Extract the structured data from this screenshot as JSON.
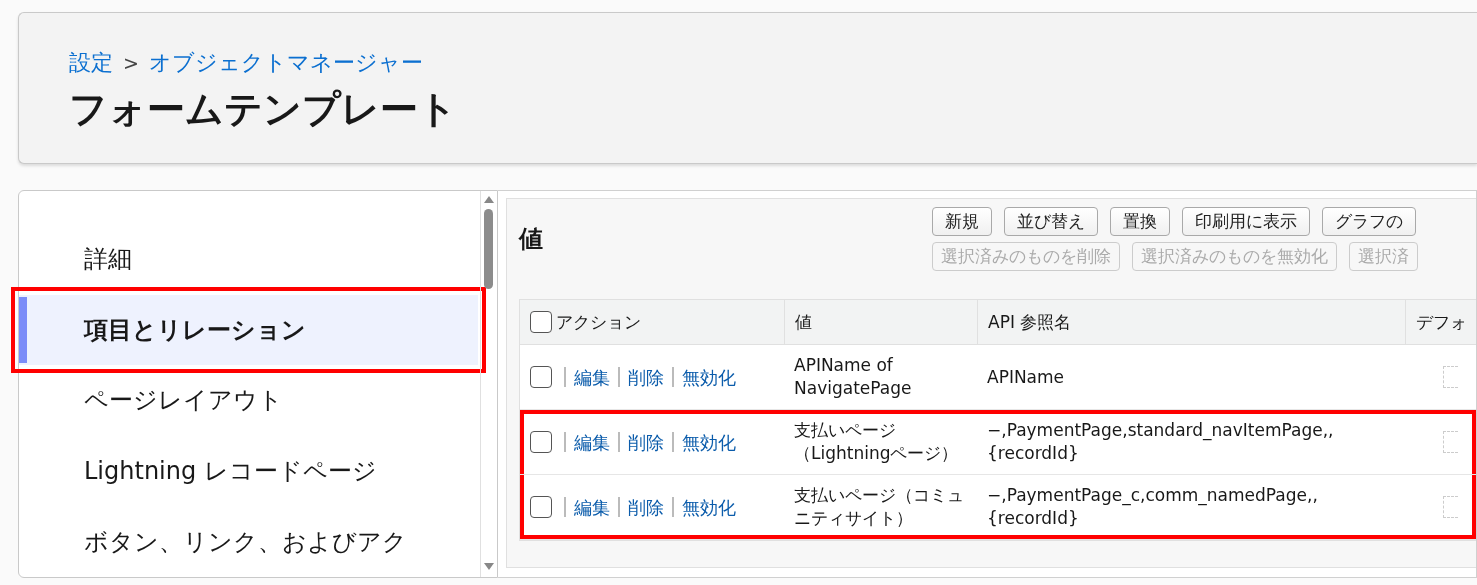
{
  "header": {
    "breadcrumb": [
      {
        "label": "設定"
      },
      {
        "label": "オブジェクトマネージャー"
      }
    ],
    "breadcrumb_separator": ">",
    "title": "フォームテンプレート"
  },
  "sidebar": {
    "items": [
      {
        "label": "詳細",
        "selected": false,
        "highlighted": false
      },
      {
        "label": "項目とリレーション",
        "selected": true,
        "highlighted": true
      },
      {
        "label": "ページレイアウト",
        "selected": false,
        "highlighted": false
      },
      {
        "label": "Lightning レコードページ",
        "selected": false,
        "highlighted": false
      },
      {
        "label": "ボタン、リンク、およびアク",
        "selected": false,
        "highlighted": false
      }
    ]
  },
  "panel": {
    "title": "値",
    "buttons": [
      {
        "label": "新規",
        "disabled": false
      },
      {
        "label": "並び替え",
        "disabled": false
      },
      {
        "label": "置換",
        "disabled": false
      },
      {
        "label": "印刷用に表示",
        "disabled": false
      },
      {
        "label": "グラフの",
        "disabled": false
      }
    ],
    "bulk_buttons": [
      {
        "label": "選択済みのものを削除",
        "disabled": true
      },
      {
        "label": "選択済みのものを無効化",
        "disabled": true
      },
      {
        "label": "選択済",
        "disabled": true
      }
    ],
    "table": {
      "select_all_checked": false,
      "columns": [
        "アクション",
        "値",
        "API 参照名",
        "デフォ"
      ],
      "rows": [
        {
          "checked": false,
          "actions": [
            "編集",
            "削除",
            "無効化"
          ],
          "value": "APIName of NavigatePage",
          "api_name": "APIName",
          "highlighted": false
        },
        {
          "checked": false,
          "actions": [
            "編集",
            "削除",
            "無効化"
          ],
          "value": "支払いページ（Lightningページ）",
          "api_name": "−,PaymentPage,standard_navItemPage,,{recordId}",
          "highlighted": true
        },
        {
          "checked": false,
          "actions": [
            "編集",
            "削除",
            "無効化"
          ],
          "value": "支払いページ（コミュニティサイト）",
          "api_name": "−,PaymentPage_c,comm_namedPage,,{recordId}",
          "highlighted": true
        }
      ]
    }
  }
}
